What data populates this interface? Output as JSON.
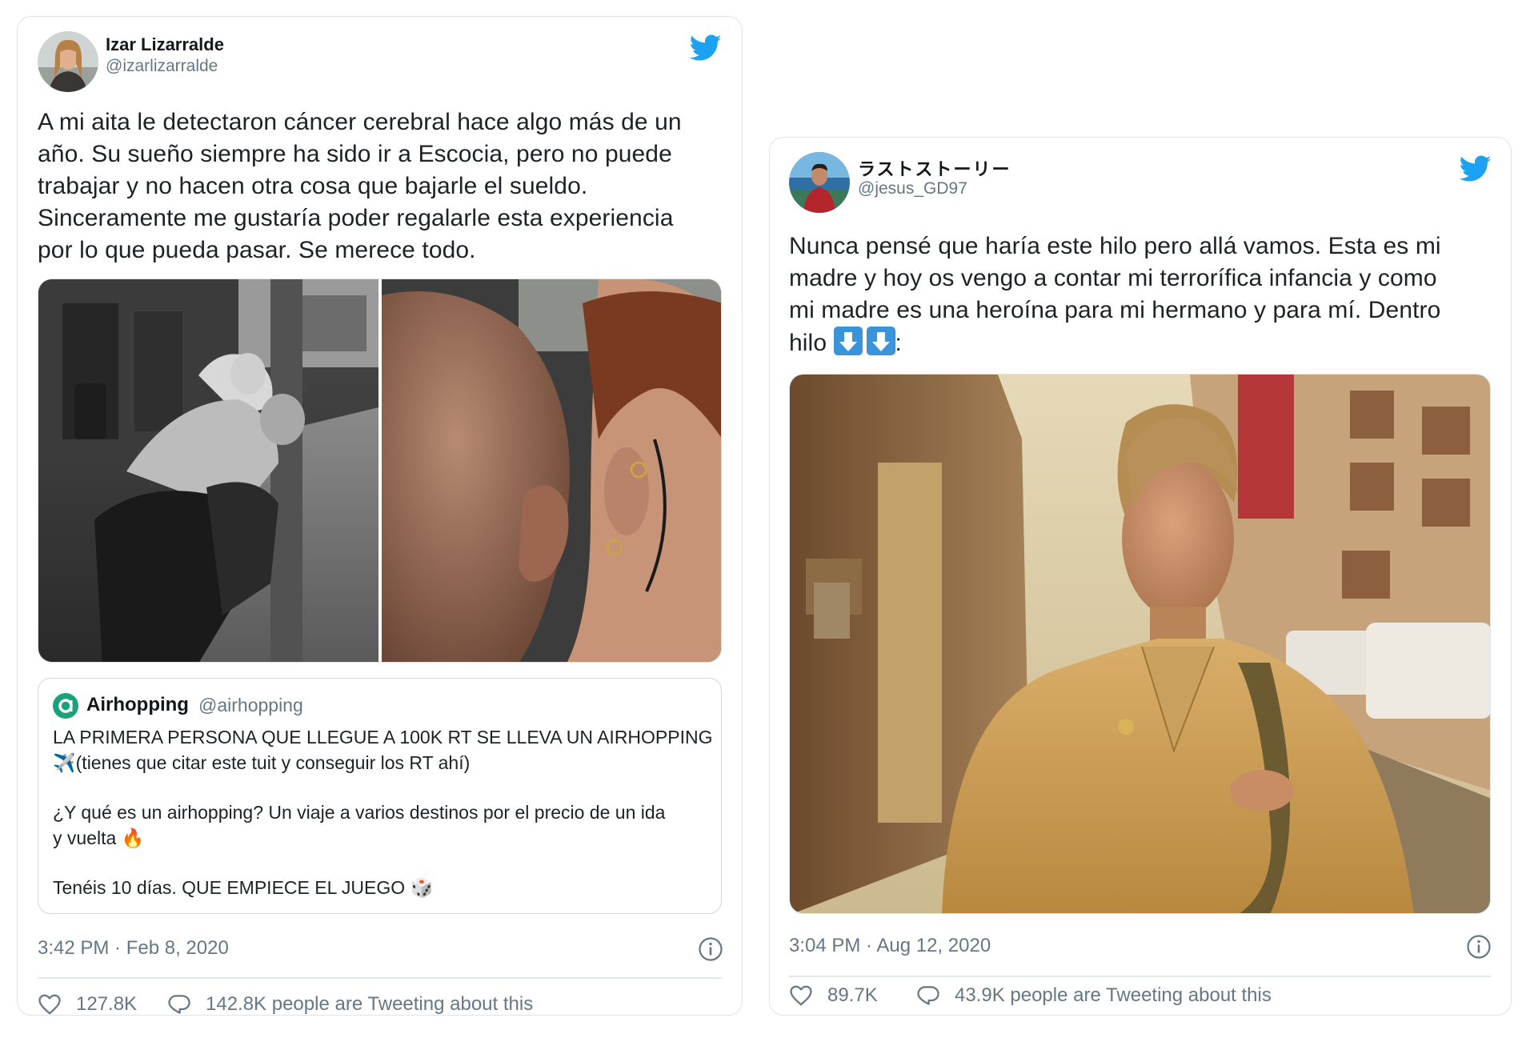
{
  "tweet_left": {
    "display_name": "Izar Lizarralde",
    "handle": "@izarlizarralde",
    "text_lines": [
      "A mi aita le detectaron cáncer cerebral hace algo más de un",
      "año. Su sueño siempre ha sido ir a Escocia, pero no puede",
      "trabajar y no hacen otra cosa que bajarle el sueldo.",
      "Sinceramente me gustaría poder regalarle esta experiencia",
      "por lo que pueda pasar. Se merece todo."
    ],
    "quote": {
      "display_name": "Airhopping",
      "handle": "@airhopping",
      "line1": "LA PRIMERA PERSONA QUE LLEGUE A 100K RT SE LLEVA UN AIRHOPPING",
      "line2_emoji": "✈️",
      "line2": "(tienes que citar este tuit y conseguir los RT ahí)",
      "line3": "¿Y qué es un airhopping? Un viaje a varios destinos por el precio de un ida",
      "line4": "y vuelta",
      "line4_emoji": "🔥",
      "line5": "Tenéis 10 días. QUE EMPIECE EL JUEGO",
      "line5_emoji": "🎲"
    },
    "timestamp": "3:42 PM · Feb 8, 2020",
    "likes": "127.8K",
    "tweeting_about": "142.8K people are Tweeting about this"
  },
  "tweet_right": {
    "display_name": "ラストストーリー",
    "handle": "@jesus_GD97",
    "text_lines": [
      "Nunca pensé que haría este hilo pero allá vamos. Esta es mi",
      "madre y hoy os vengo a contar mi terrorífica infancia y como",
      "mi madre es una heroína para mi hermano y para mí. Dentro"
    ],
    "last_line_prefix": "hilo",
    "last_line_suffix": ":",
    "timestamp": "3:04 PM · Aug 12, 2020",
    "likes": "89.7K",
    "tweeting_about": "43.9K people are Tweeting about this"
  },
  "colors": {
    "twitter_blue": "#1da1f2",
    "secondary_text": "#657786",
    "airhopping_green": "#1aa37a",
    "border": "#dfe3e6"
  },
  "icons": [
    "twitter-bird-icon",
    "info-icon",
    "heart-icon",
    "speech-bubble-icon",
    "down-arrow-emoji-icon",
    "airhopping-logo-icon"
  ]
}
